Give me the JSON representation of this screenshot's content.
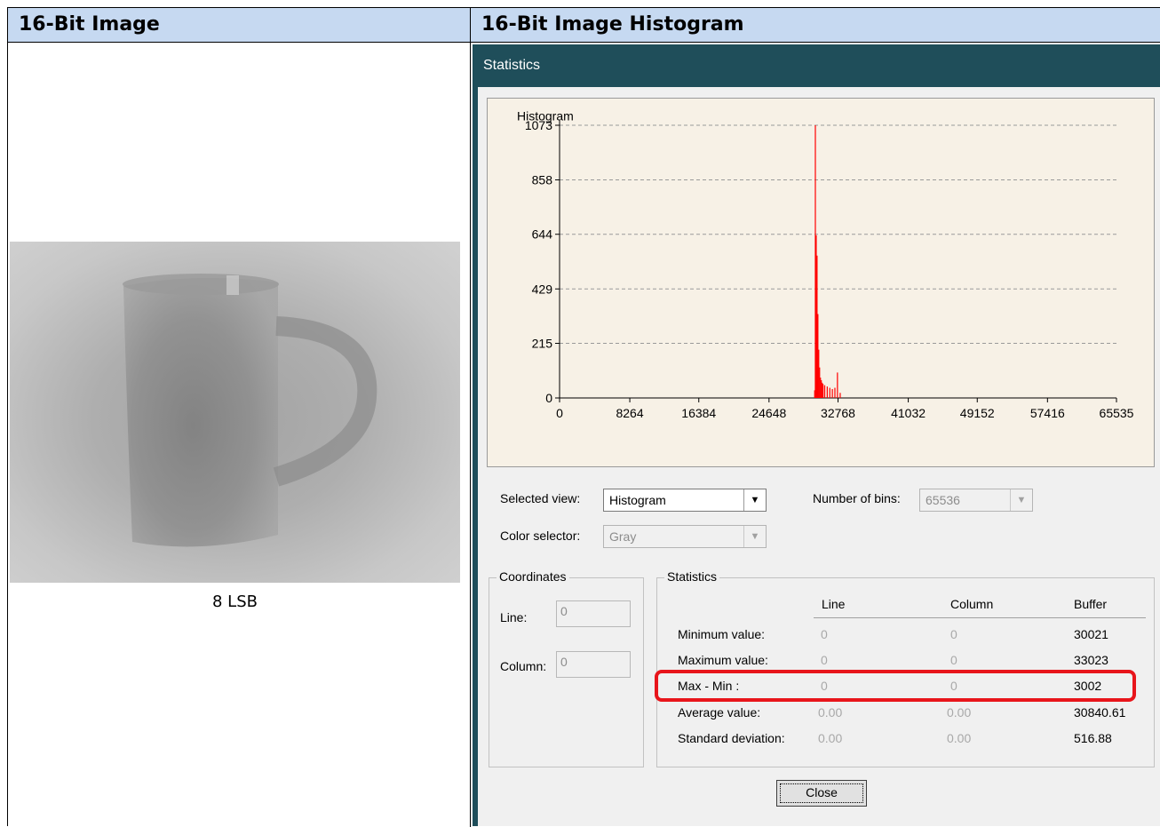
{
  "headers": {
    "left": "16-Bit Image",
    "right": "16-Bit Image Histogram"
  },
  "left_caption": "8 LSB",
  "window": {
    "title": "Statistics"
  },
  "chart_data": {
    "type": "bar",
    "title": "Histogram",
    "ylim": [
      0,
      1073
    ],
    "xlim": [
      0,
      65535
    ],
    "y_ticks": [
      "1073",
      "858",
      "644",
      "429",
      "215",
      "0"
    ],
    "x_ticks": [
      "0",
      "8264",
      "16384",
      "24648",
      "32768",
      "41032",
      "49152",
      "57416",
      "65535"
    ],
    "series": [
      {
        "color": "#ff0000",
        "x": [
          30021,
          30100,
          30200,
          30300,
          30400,
          30500,
          30600,
          30700,
          30800,
          30900,
          31000,
          31200,
          31500,
          31800,
          32100,
          32400,
          32700,
          33023
        ],
        "values": [
          30,
          1073,
          640,
          560,
          330,
          190,
          120,
          80,
          70,
          60,
          55,
          50,
          45,
          40,
          35,
          40,
          100,
          20
        ]
      }
    ]
  },
  "controls": {
    "selected_view_label": "Selected view:",
    "selected_view_value": "Histogram",
    "color_selector_label": "Color selector:",
    "color_selector_value": "Gray",
    "bins_label": "Number of bins:",
    "bins_value": "65536",
    "dropdown_glyph": "▼"
  },
  "coordinates": {
    "title": "Coordinates",
    "line_label": "Line:",
    "line_value": "0",
    "column_label": "Column:",
    "column_value": "0"
  },
  "statistics": {
    "title": "Statistics",
    "col_line": "Line",
    "col_column": "Column",
    "col_buffer": "Buffer",
    "rows": [
      {
        "label": "Minimum value:",
        "line": "0",
        "column": "0",
        "buffer": "30021"
      },
      {
        "label": "Maximum value:",
        "line": "0",
        "column": "0",
        "buffer": "33023"
      },
      {
        "label": "Max - Min :",
        "line": "0",
        "column": "0",
        "buffer": "3002"
      },
      {
        "label": "Average value:",
        "line": "0.00",
        "column": "0.00",
        "buffer": "30840.61"
      },
      {
        "label": "Standard deviation:",
        "line": "0.00",
        "column": "0.00",
        "buffer": "516.88"
      }
    ]
  },
  "close_label": "Close"
}
